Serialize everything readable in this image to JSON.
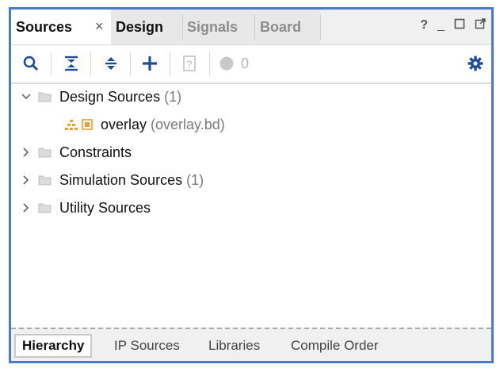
{
  "tabs": {
    "sources": "Sources",
    "design": "Design",
    "signals": "Signals",
    "board": "Board",
    "close": "×"
  },
  "window_controls": {
    "help": "?",
    "minimize": "_"
  },
  "toolbar": {
    "message_count": "0"
  },
  "tree": {
    "design_sources": {
      "label": "Design Sources",
      "count": "(1)"
    },
    "overlay": {
      "label": "overlay",
      "file": "(overlay.bd)"
    },
    "constraints": {
      "label": "Constraints"
    },
    "simulation_sources": {
      "label": "Simulation Sources",
      "count": "(1)"
    },
    "utility_sources": {
      "label": "Utility Sources"
    }
  },
  "bottom_tabs": {
    "hierarchy": "Hierarchy",
    "ip_sources": "IP Sources",
    "libraries": "Libraries",
    "compile_order": "Compile Order"
  },
  "colors": {
    "frame_border": "#4a78cf",
    "toolbar_icon": "#1f4e96",
    "bd_icon": "#e8a030"
  }
}
